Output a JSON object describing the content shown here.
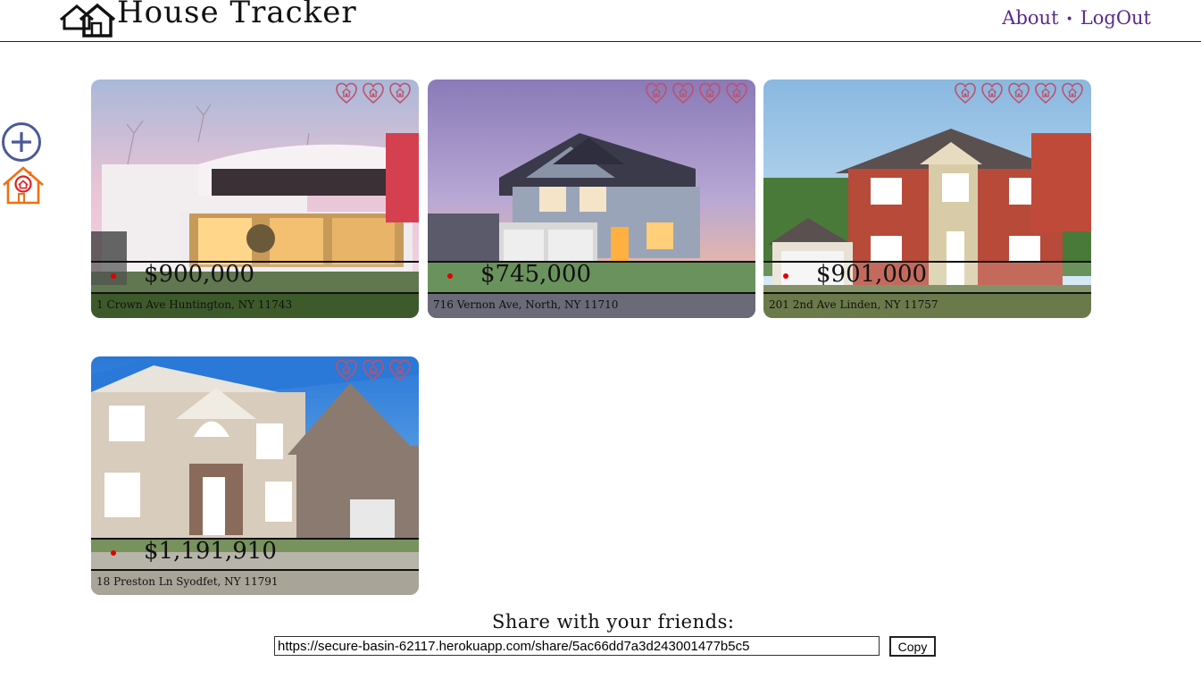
{
  "header": {
    "title": "House Tracker",
    "nav": {
      "about": "About",
      "separator": "•",
      "logout": "LogOut"
    }
  },
  "sidebar": {
    "add_icon": "plus-circle-icon",
    "house_icon": "house-icon"
  },
  "colors": {
    "nav": "#5a2a8a",
    "heart": "#c0506a",
    "dot": "#e00000",
    "add": "#4a5a9a",
    "house": "#f07010"
  },
  "listings": [
    {
      "price": "$900,000",
      "address": "1 Crown Ave Huntington, NY 11743",
      "hearts": 3
    },
    {
      "price": "$745,000",
      "address": "716 Vernon Ave, North, NY 11710",
      "hearts": 4
    },
    {
      "price": "$901,000",
      "address": "201 2nd Ave Linden, NY 11757",
      "hearts": 5
    },
    {
      "price": "$1,191,910",
      "address": "18 Preston Ln Syodfet, NY 11791",
      "hearts": 3
    }
  ],
  "share": {
    "label": "Share with your friends:",
    "url": "https://secure-basin-62117.herokuapp.com/share/5ac66dd7a3d243001477b5c5",
    "copy_label": "Copy"
  }
}
